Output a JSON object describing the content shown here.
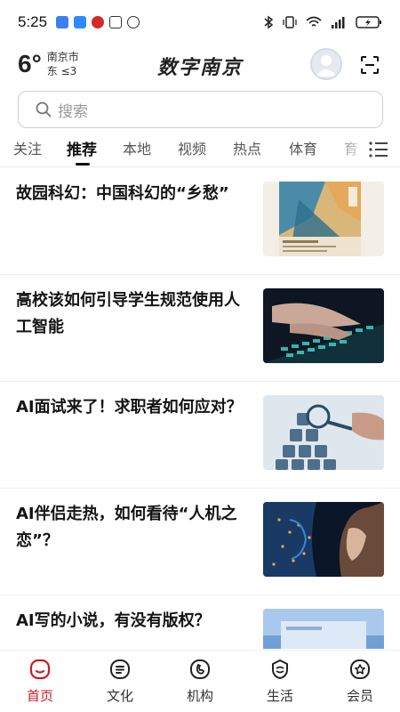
{
  "status_bar": {
    "time": "5:25",
    "app_icon_colors": [
      "#3b7ff0",
      "#2b8cff",
      "#d42a2a",
      "#333333",
      "#333333"
    ],
    "right_icons": [
      "bluetooth-icon",
      "vibrate-icon",
      "wifi-icon",
      "signal-icon",
      "battery-icon"
    ]
  },
  "header": {
    "temperature": "6°",
    "city": "南京市",
    "wind": "东 ≤3",
    "brand": "数字南京"
  },
  "search": {
    "placeholder": "搜索"
  },
  "tabs": [
    {
      "label": "关注"
    },
    {
      "label": "推荐",
      "active": true
    },
    {
      "label": "本地"
    },
    {
      "label": "视频"
    },
    {
      "label": "热点"
    },
    {
      "label": "体育"
    },
    {
      "label": "育"
    }
  ],
  "news": [
    {
      "title": "故园科幻：中国科幻的“乡愁”"
    },
    {
      "title": "高校该如何引导学生规范使用人工智能"
    },
    {
      "title": "AI面试来了！求职者如何应对？"
    },
    {
      "title": "AI伴侣走热，如何看待“人机之恋”？"
    },
    {
      "title": "AI写的小说，有没有版权？"
    }
  ],
  "bottom_nav": [
    {
      "label": "首页",
      "icon": "home-icon",
      "active": true
    },
    {
      "label": "文化",
      "icon": "culture-icon"
    },
    {
      "label": "机构",
      "icon": "institution-icon"
    },
    {
      "label": "生活",
      "icon": "life-icon"
    },
    {
      "label": "会员",
      "icon": "member-icon"
    }
  ],
  "colors": {
    "accent": "#c81d25",
    "text": "#141414",
    "muted": "#9a9a9a"
  }
}
